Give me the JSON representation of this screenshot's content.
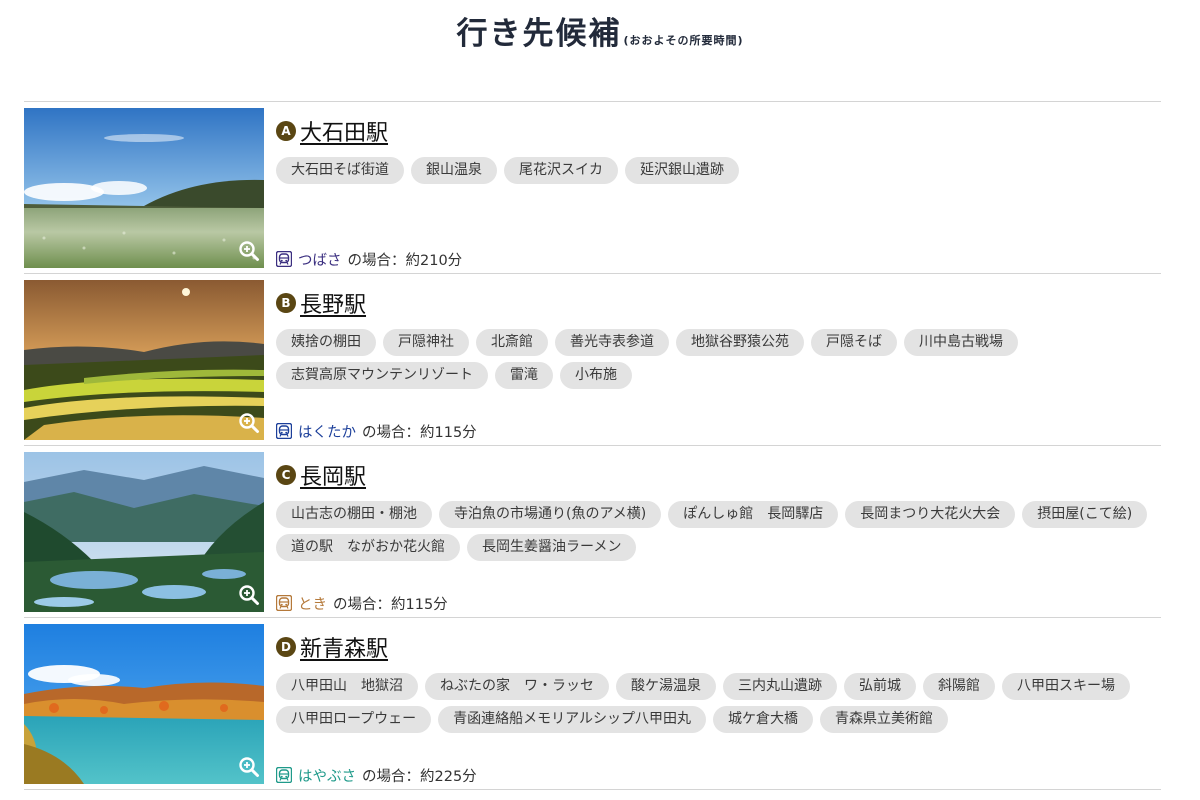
{
  "header": {
    "title": "行き先候補",
    "subtitle": "(おおよその所要時間)"
  },
  "colors": {
    "badge": "#5a4613",
    "tag_bg": "#e3e3e3",
    "divider": "#d4d4d4",
    "title": "#222a3a"
  },
  "destinations": [
    {
      "badge": "A",
      "name": "大石田駅",
      "spots": [
        "大石田そば街道",
        "銀山温泉",
        "尾花沢スイカ",
        "延沢銀山遺跡"
      ],
      "train": {
        "name": "つばさ",
        "color": "#3b2f80",
        "suffix": "の場合：約210分"
      }
    },
    {
      "badge": "B",
      "name": "長野駅",
      "spots": [
        "姨捨の棚田",
        "戸隠神社",
        "北斎館",
        "善光寺表参道",
        "地獄谷野猿公苑",
        "戸隠そば",
        "川中島古戦場",
        "志賀高原マウンテンリゾート",
        "雷滝",
        "小布施"
      ],
      "train": {
        "name": "はくたか",
        "color": "#1c3f9a",
        "suffix": "の場合：約115分"
      }
    },
    {
      "badge": "C",
      "name": "長岡駅",
      "spots": [
        "山古志の棚田・棚池",
        "寺泊魚の市場通り(魚のアメ横)",
        "ぽんしゅ館　長岡驛店",
        "長岡まつり大花火大会",
        "摂田屋(こて絵)",
        "道の駅　ながおか花火館",
        "長岡生姜醤油ラーメン"
      ],
      "train": {
        "name": "とき",
        "color": "#b5793a",
        "suffix": "の場合：約115分"
      }
    },
    {
      "badge": "D",
      "name": "新青森駅",
      "spots": [
        "八甲田山　地獄沼",
        "ねぶたの家　ワ・ラッセ",
        "酸ケ湯温泉",
        "三内丸山遺跡",
        "弘前城",
        "斜陽館",
        "八甲田スキー場",
        "八甲田ロープウェー",
        "青函連絡船メモリアルシップ八甲田丸",
        "城ケ倉大橋",
        "青森県立美術館"
      ],
      "train": {
        "name": "はやぶさ",
        "color": "#1f9a8a",
        "suffix": "の場合：約225分"
      }
    }
  ]
}
